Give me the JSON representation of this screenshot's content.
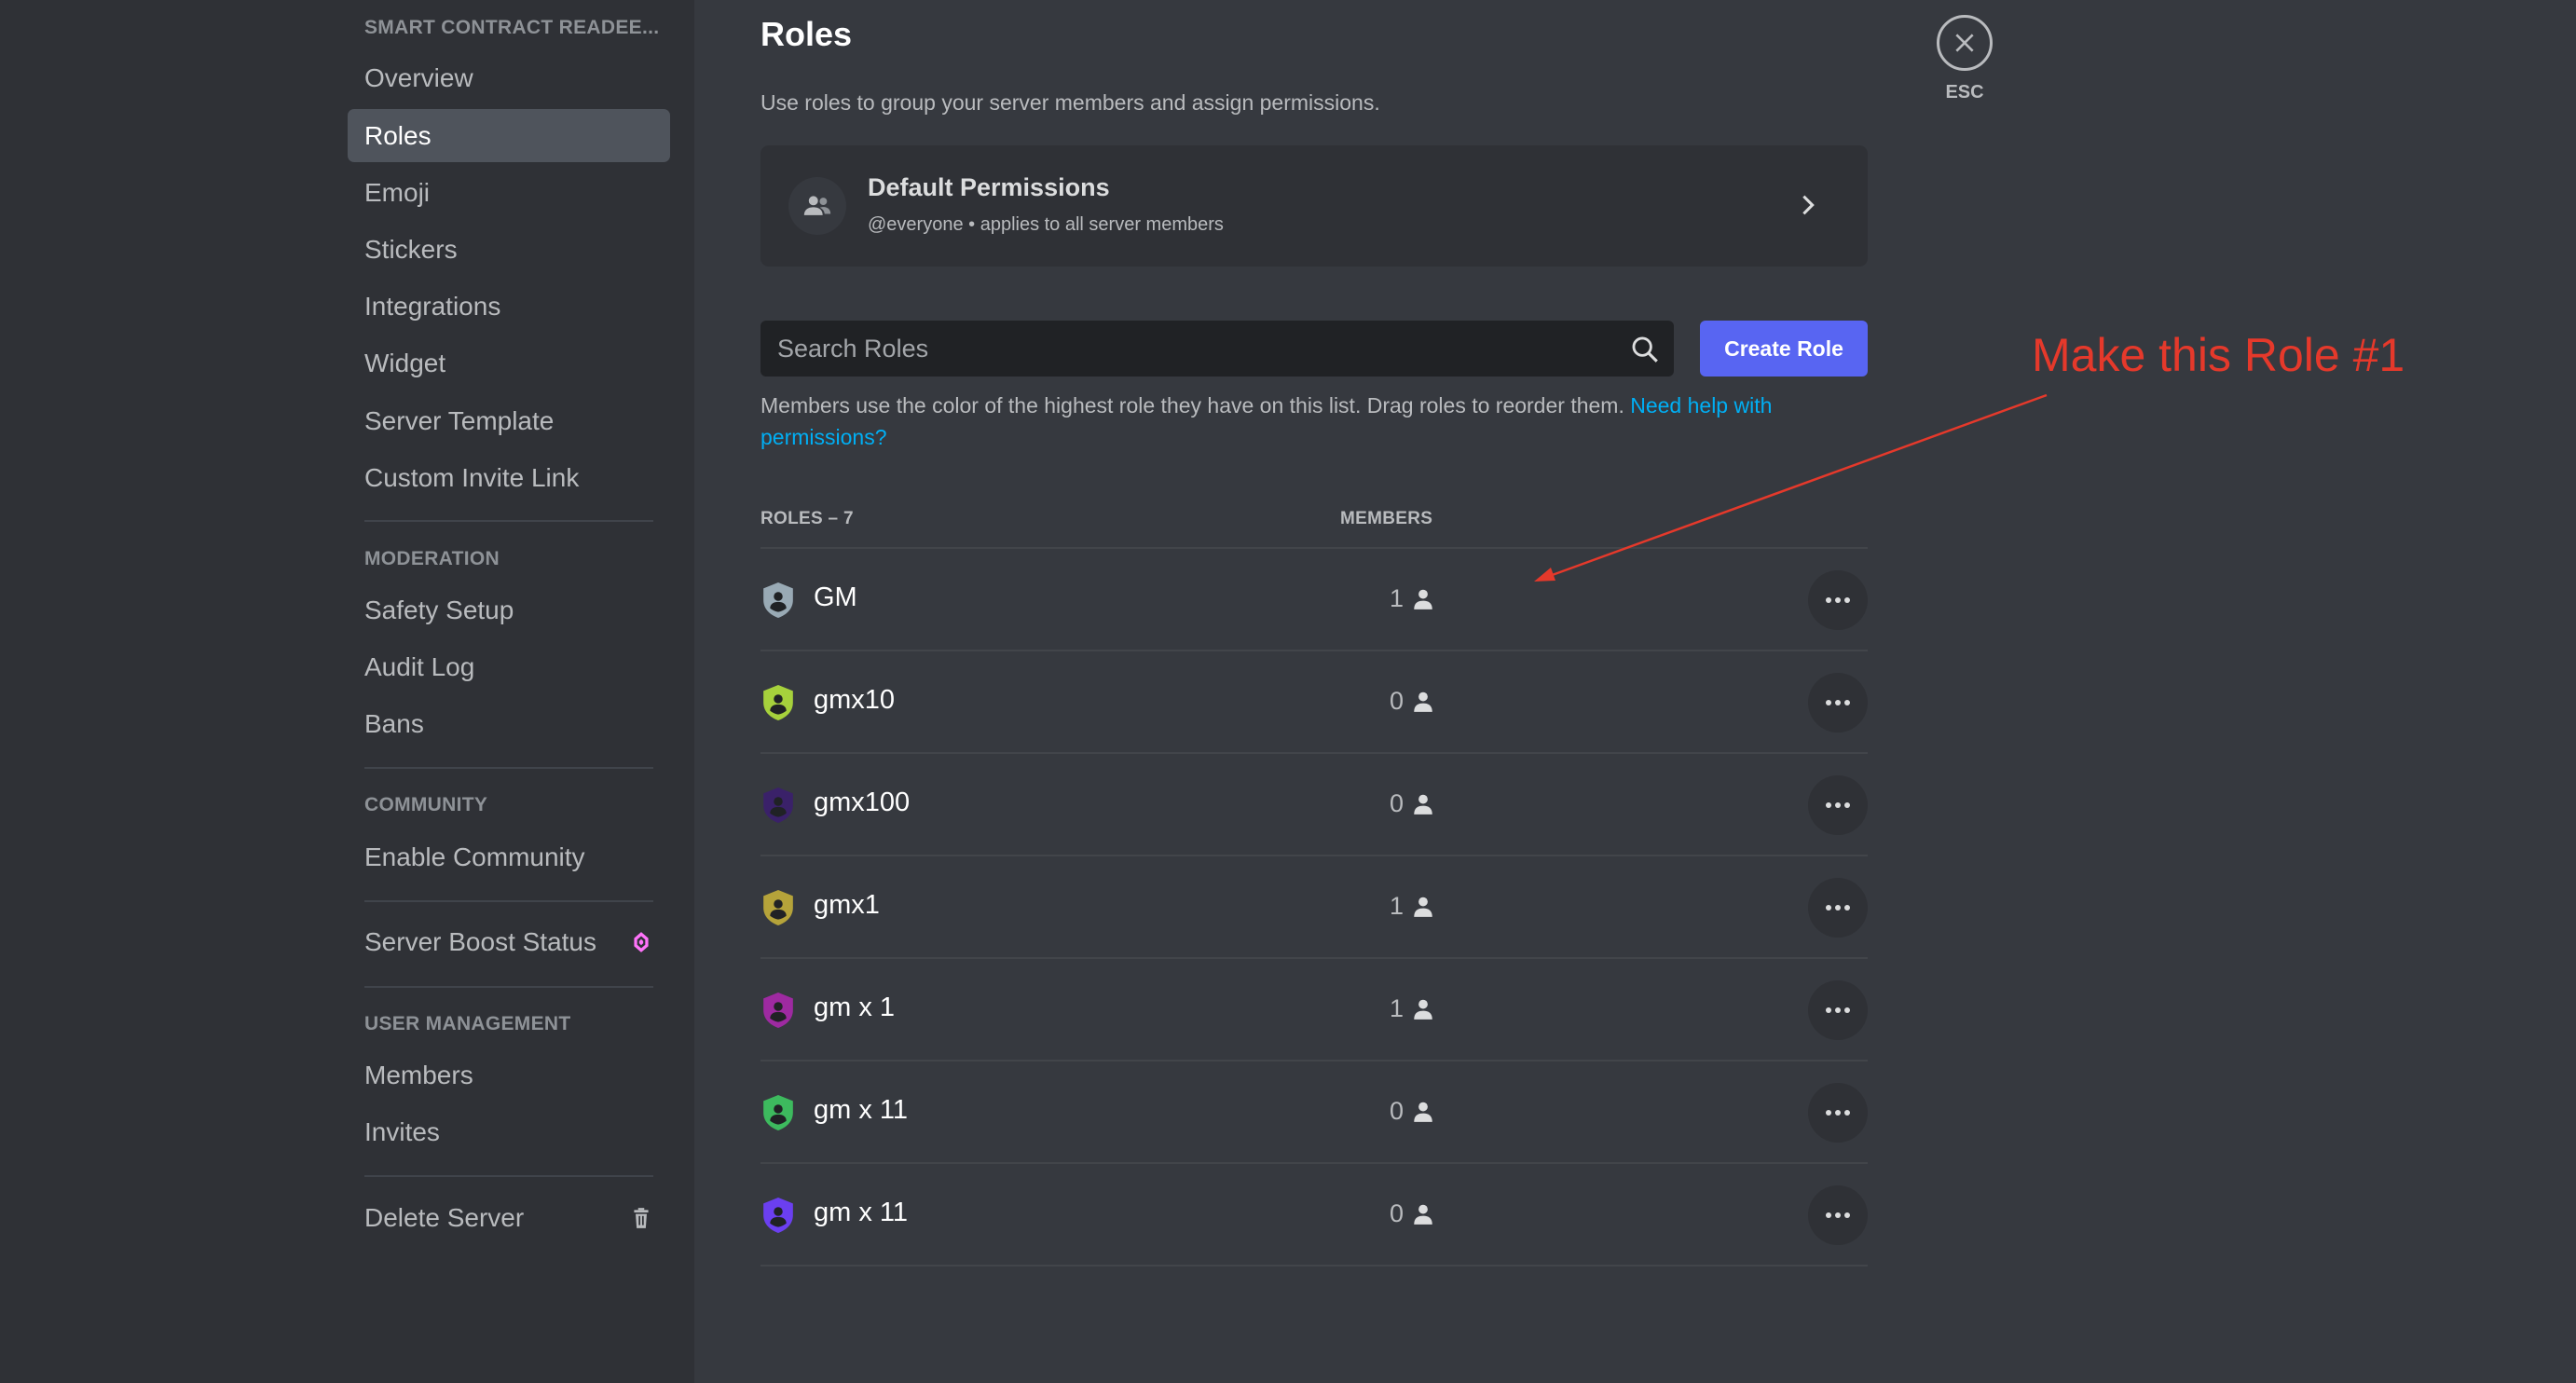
{
  "sidebar": {
    "server_name": "SMART CONTRACT READEE...",
    "items_top": [
      {
        "label": "Overview",
        "active": false
      },
      {
        "label": "Roles",
        "active": true
      },
      {
        "label": "Emoji",
        "active": false
      },
      {
        "label": "Stickers",
        "active": false
      },
      {
        "label": "Integrations",
        "active": false
      },
      {
        "label": "Widget",
        "active": false
      },
      {
        "label": "Server Template",
        "active": false
      },
      {
        "label": "Custom Invite Link",
        "active": false
      }
    ],
    "moderation_header": "MODERATION",
    "moderation_items": [
      "Safety Setup",
      "Audit Log",
      "Bans"
    ],
    "community_header": "COMMUNITY",
    "community_items": [
      "Enable Community"
    ],
    "boost_label": "Server Boost Status",
    "user_mgmt_header": "USER MANAGEMENT",
    "user_mgmt_items": [
      "Members",
      "Invites"
    ],
    "delete_label": "Delete Server"
  },
  "main": {
    "title": "Roles",
    "subtitle": "Use roles to group your server members and assign permissions.",
    "default_permissions": {
      "title": "Default Permissions",
      "subtitle": "@everyone • applies to all server members"
    },
    "search_placeholder": "Search Roles",
    "create_role_label": "Create Role",
    "help_text": "Members use the color of the highest role they have on this list. Drag roles to reorder them.",
    "help_link": "Need help with permissions?",
    "roles_header": "ROLES – 7",
    "members_header": "MEMBERS",
    "roles": [
      {
        "name": "GM",
        "members": "1",
        "color": "#99aab5"
      },
      {
        "name": "gmx10",
        "members": "0",
        "color": "#a6d13c"
      },
      {
        "name": "gmx100",
        "members": "0",
        "color": "#3a2169"
      },
      {
        "name": "gmx1",
        "members": "1",
        "color": "#b5a33a"
      },
      {
        "name": "gm x 1",
        "members": "1",
        "color": "#9e2aa1"
      },
      {
        "name": "gm x 11",
        "members": "0",
        "color": "#3dba5e"
      },
      {
        "name": "gm x 11",
        "members": "0",
        "color": "#6b3ff0"
      }
    ]
  },
  "esc_label": "ESC",
  "annotation": {
    "text": "Make this Role #1",
    "color": "#e5392b"
  },
  "colors": {
    "accent": "#5865f2",
    "link": "#00aff4",
    "boost": "#ff73fa"
  }
}
